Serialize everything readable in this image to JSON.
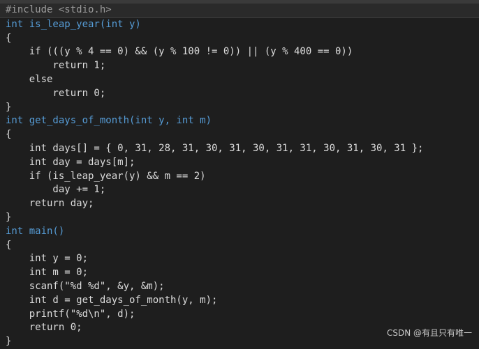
{
  "code": {
    "lines": [
      "#include <stdio.h>",
      "int is_leap_year(int y)",
      "{",
      "    if (((y % 4 == 0) && (y % 100 != 0)) || (y % 400 == 0))",
      "        return 1;",
      "    else",
      "        return 0;",
      "}",
      "int get_days_of_month(int y, int m)",
      "{",
      "    int days[] = { 0, 31, 28, 31, 30, 31, 30, 31, 31, 30, 31, 30, 31 };",
      "    int day = days[m];",
      "    if (is_leap_year(y) && m == 2)",
      "        day += 1;",
      "    return day;",
      "}",
      "int main()",
      "{",
      "    int y = 0;",
      "    int m = 0;",
      "    scanf(\"%d %d\", &y, &m);",
      "    int d = get_days_of_month(y, m);",
      "    printf(\"%d\\n\", d);",
      "    return 0;",
      "}"
    ]
  },
  "watermark": "CSDN @有且只有唯一"
}
